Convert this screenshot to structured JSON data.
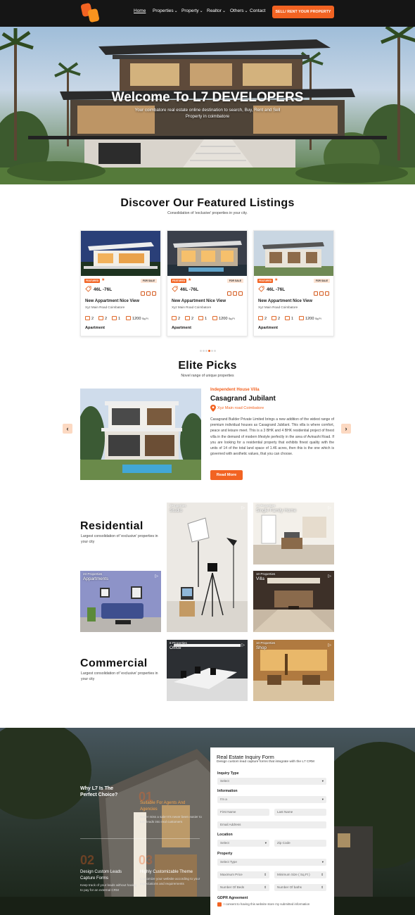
{
  "nav": {
    "links": [
      {
        "label": "Home",
        "caret": ""
      },
      {
        "label": "Properties",
        "caret": "⌄"
      },
      {
        "label": "Property",
        "caret": "⌄"
      },
      {
        "label": "Realtor",
        "caret": "⌄"
      },
      {
        "label": "Others",
        "caret": "⌄"
      },
      {
        "label": "Contact",
        "caret": ""
      }
    ],
    "cta": "SELL/ RENT YOUR PROPERTY"
  },
  "hero": {
    "title": "Welcome To L7 DEVELOPERS",
    "subtitle": "Your coimbatore real estate online destination to search, Buy, Rent and Sell Property in coimbatore"
  },
  "featured": {
    "title": "Discover Our Featured Listings",
    "subtitle": "Consolidation of 'exclusive' properties in your city.",
    "cards": [
      {
        "badge": "FEATURED",
        "status": "FOR SALE",
        "price": "46L -76L",
        "title": "New Appartment Nice View",
        "address": "Xyz Main Road Coimbatore",
        "beds": "2",
        "baths": "2",
        "garage": "1",
        "area": "1200",
        "area_unit": "Sq.Ft",
        "type": "Apartment"
      },
      {
        "badge": "FEATURED",
        "status": "FOR SALE",
        "price": "46L -76L",
        "title": "New Appartment Nice View",
        "address": "Xyz Main Road Coimbatore",
        "beds": "2",
        "baths": "2",
        "garage": "1",
        "area": "1200",
        "area_unit": "Sq.Ft",
        "type": "Apartment"
      },
      {
        "badge": "FEATURED",
        "status": "FOR SALE",
        "price": "46L -76L",
        "title": "New Appartment Nice View",
        "address": "Xyz Main Road Coimbatore",
        "beds": "2",
        "baths": "2",
        "garage": "1",
        "area": "1200",
        "area_unit": "Sq.Ft",
        "type": "Apartment"
      }
    ]
  },
  "elite": {
    "title": "Elite Picks",
    "subtitle": "Novel range of unique properties",
    "category": "Independent House Villa",
    "name": "Casagrand Jubilant",
    "location": "Xyz Main road Coimbatore",
    "description": "Casagrand Builder Private Limited brings a new addition of the widest range of premium individual houses as Casagrand Jubilant. This villa is where comfort, peace and leisure meet. This is a 3 BHK and 4 BHK residential project of finest villa in the demand of modern lifestyle perfectly in the area of Avinashi Road. If you are looking for a residential property that exhibits finest quality with the units of 14 of the total land space of 1.46 acres, then this is the one which is governed with aesthetic values, that you can choose.",
    "button": "Read More",
    "prev": "‹",
    "next": "›"
  },
  "residential": {
    "title": "Residential",
    "subtitle": "Largest consolidation of 'exclusive' properties in your city",
    "tiles": [
      {
        "count": "7Properties",
        "name": "Studio"
      },
      {
        "count": "10 Properties",
        "name": "Single Family Home"
      },
      {
        "count": "23 Properties",
        "name": "Appartments"
      },
      {
        "count": "10 Properties",
        "name": "Villa"
      }
    ]
  },
  "commercial": {
    "title": "Commercial",
    "subtitle": "Largest consolidation of 'exclusive' properties in your city",
    "tiles": [
      {
        "count": "8 Properties",
        "name": "Office"
      },
      {
        "count": "10 Properties",
        "name": "Shop"
      }
    ]
  },
  "why": {
    "title": "Why L7 Is The Perfect Choice?",
    "items": [
      {
        "num": "01",
        "title": "Suitable For Agents And Agencies",
        "text": "Never miss a sale! It's never been easier to turn leads into real customers"
      },
      {
        "num": "02",
        "title": "Design Custom Leads Capture Forms",
        "text": "Keep track of your leads without having to pay for an external CRM"
      },
      {
        "num": "03",
        "title": "Highly Customizable Theme",
        "text": "Customize your website according to your expectations and requirements"
      }
    ]
  },
  "form": {
    "title": "Real Estate Inquiry Form",
    "subtitle": "Design custom lead capture forms that integrate with the L7 CRM",
    "inquiry_label": "Inquiry Type",
    "inquiry_value": "Select",
    "information_label": "Information",
    "information_value": "I'm a",
    "first_name": "First Name",
    "last_name": "Last Name",
    "email": "Email Address",
    "location_label": "Location",
    "location_value": "Select",
    "zip": "Zip Code",
    "property_label": "Property",
    "property_value": "Select Type",
    "max_price": "Maximum Price",
    "min_size": "Minimum Size ( Sq.Ft )",
    "beds": "Number Of Beds",
    "baths": "Number Of baths",
    "gdpr_label": "GDPR Agreement",
    "gdpr_text": "I consent to having this website store my submitted information"
  },
  "colors": {
    "accent": "#f26322",
    "nav_bg": "#151515"
  }
}
